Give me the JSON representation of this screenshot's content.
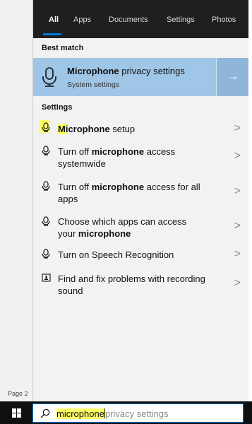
{
  "tabs": [
    "All",
    "Apps",
    "Documents",
    "Settings",
    "Photos"
  ],
  "best_match": {
    "section_title": "Best match",
    "title_bold": "Microphone",
    "title_rest": " privacy settings",
    "subtitle": "System settings",
    "arrow": "→"
  },
  "settings": {
    "section_title": "Settings",
    "items": [
      {
        "pre": "",
        "hl": "Mi",
        "bold": "crophone",
        "post": " setup",
        "icon": "microphone-icon"
      },
      {
        "pre": "Turn off ",
        "bold": "microphone",
        "post": " access systemwide",
        "icon": "microphone-icon"
      },
      {
        "pre": "Turn off ",
        "bold": "microphone",
        "post": " access for all apps",
        "icon": "microphone-icon"
      },
      {
        "pre": "Choose which apps can access your ",
        "bold": "microphone",
        "post": "",
        "icon": "microphone-icon"
      },
      {
        "pre": "Turn on Speech Recognition",
        "bold": "",
        "post": "",
        "icon": "microphone-icon"
      },
      {
        "pre": "Find and fix problems with recording sound",
        "bold": "",
        "post": "",
        "icon": "troubleshoot-icon"
      }
    ],
    "chevron": ">"
  },
  "page_label": "Page 2",
  "search": {
    "typed": "microphone",
    "suggestion": "privacy settings"
  },
  "colors": {
    "accent": "#0078d7",
    "highlight": "#ffff66",
    "best_match_bg": "#9fc6e7"
  }
}
